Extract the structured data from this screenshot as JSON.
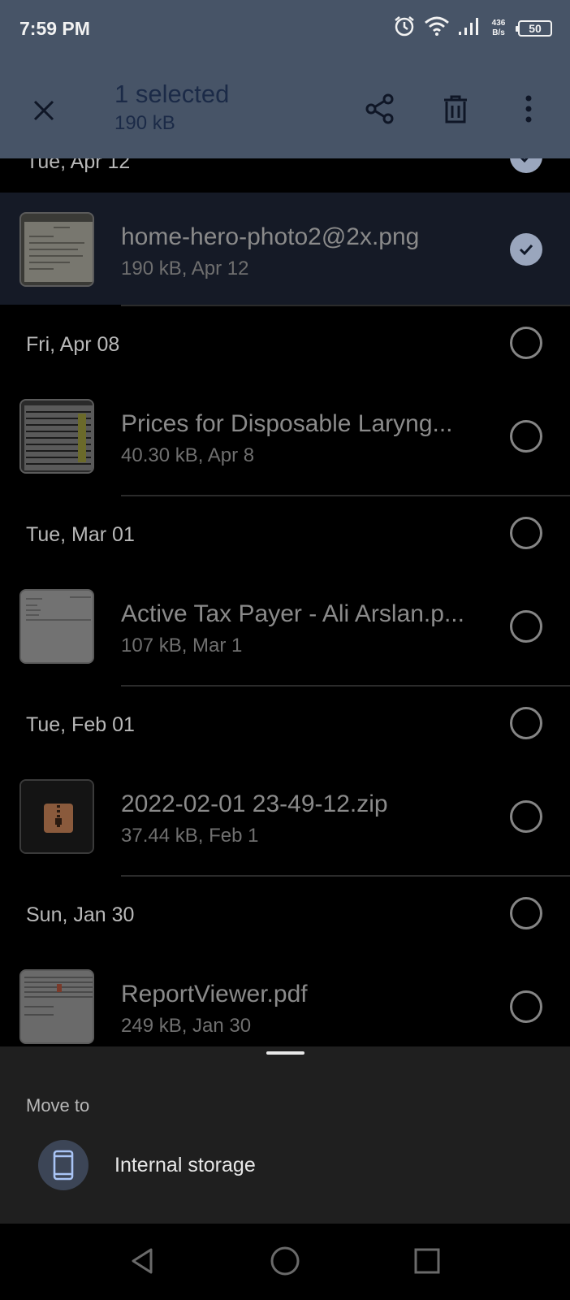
{
  "status_bar": {
    "time": "7:59 PM",
    "net_speed_value": "436",
    "net_speed_unit": "B/s",
    "battery": "50",
    "icons": [
      "alarm-icon",
      "wifi-icon",
      "signal-icon",
      "battery-icon"
    ]
  },
  "app_bar": {
    "selection_title": "1 selected",
    "selection_size": "190 kB",
    "actions": [
      "close-icon",
      "share-icon",
      "delete-icon",
      "more-icon"
    ]
  },
  "list": {
    "partial_date": "Tue, Apr 12",
    "groups": [
      {
        "date": "Fri, Apr 08",
        "file": {
          "name": "Prices for Disposable Laryng...",
          "meta": "40.30 kB, Apr 8",
          "selected": false
        }
      },
      {
        "date": "Tue, Mar 01",
        "file": {
          "name": "Active Tax Payer - Ali Arslan.p...",
          "meta": "107 kB, Mar 1",
          "selected": false
        }
      },
      {
        "date": "Tue, Feb 01",
        "file": {
          "name": "2022-02-01 23-49-12.zip",
          "meta": "37.44 kB, Feb 1",
          "selected": false
        }
      },
      {
        "date": "Sun, Jan 30",
        "file": {
          "name": "ReportViewer.pdf",
          "meta": "249 kB, Jan 30",
          "selected": false
        }
      }
    ],
    "selected_file": {
      "name": "home-hero-photo2@2x.png",
      "meta": "190 kB, Apr 12",
      "selected": true
    }
  },
  "bottom_sheet": {
    "title": "Move to",
    "item_label": "Internal storage",
    "item_icon": "phone-icon"
  },
  "colors": {
    "app_bar": "#475467",
    "selected_row": "#151a26",
    "check": "#9aa6bd",
    "sheet": "#1f1f1f"
  }
}
